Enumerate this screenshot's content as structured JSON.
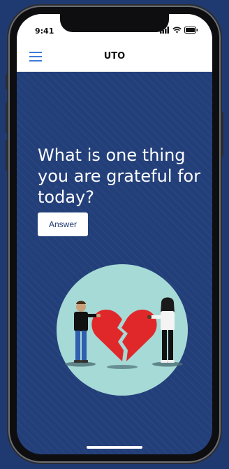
{
  "status_bar": {
    "time": "9:41"
  },
  "nav": {
    "title": "UTO"
  },
  "main": {
    "question": "What is one thing you are grateful for today?",
    "answer_button_label": "Answer"
  },
  "colors": {
    "background": "#233f7a",
    "accent": "#3f7bd9",
    "illustration_circle": "#a6dad6",
    "heart": "#e0282b"
  },
  "icons": {
    "menu": "hamburger-menu-icon",
    "signal": "signal-icon",
    "wifi": "wifi-icon",
    "battery": "battery-icon"
  }
}
